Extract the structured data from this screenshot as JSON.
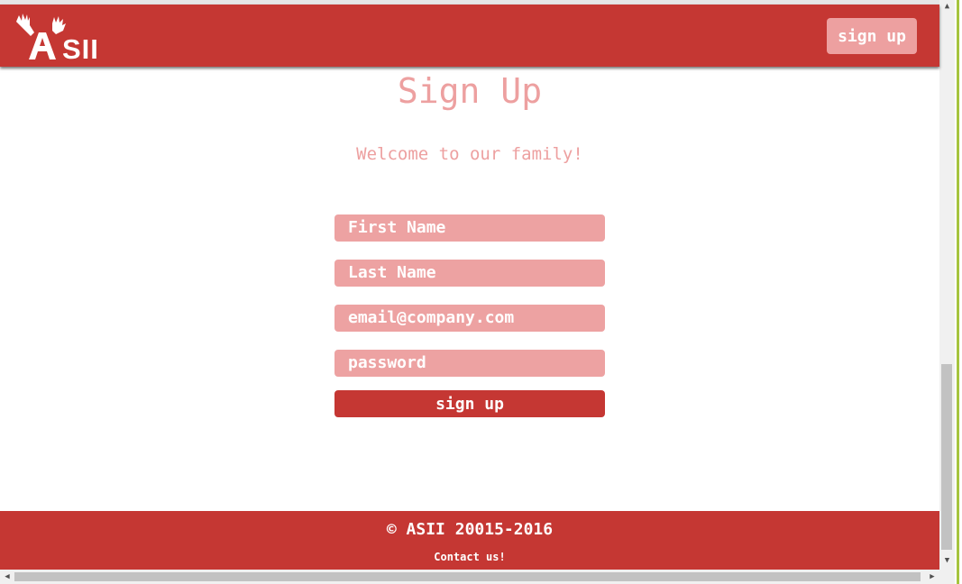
{
  "header": {
    "logo_text": "SII",
    "signup_label": "sign up"
  },
  "form": {
    "title": "Sign Up",
    "welcome": "Welcome to our family!",
    "first_name_placeholder": "First Name",
    "last_name_placeholder": "Last Name",
    "email_placeholder": "email@company.com",
    "password_placeholder": "password",
    "submit_label": "sign up"
  },
  "footer": {
    "copyright": "© ASII 20015-2016",
    "contact": "Contact us!"
  },
  "colors": {
    "brand": "#c53733",
    "brand_light": "#eda0a0"
  },
  "icons": {
    "logo": "asii-hands-logo",
    "scroll_up": "arrow-up-icon",
    "scroll_down": "arrow-down-icon",
    "scroll_left": "arrow-left-icon",
    "scroll_right": "arrow-right-icon"
  }
}
